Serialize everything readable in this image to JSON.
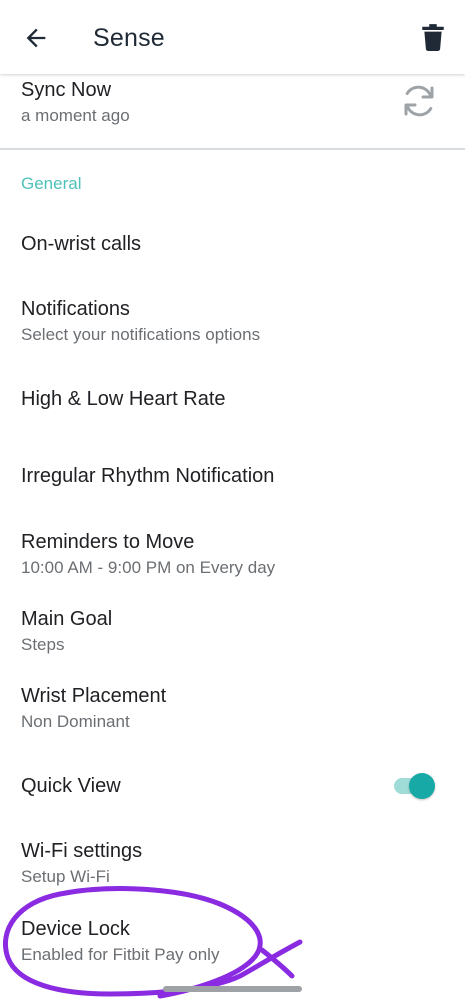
{
  "header": {
    "title": "Sense",
    "back_icon": "arrow-back-icon",
    "delete_icon": "trash-icon"
  },
  "sync": {
    "title": "Sync Now",
    "subtitle": "a moment ago",
    "icon": "sync-icon"
  },
  "general": {
    "header": "General",
    "items": [
      {
        "title": "On-wrist calls",
        "subtitle": ""
      },
      {
        "title": "Notifications",
        "subtitle": "Select your notifications options"
      },
      {
        "title": "High & Low Heart Rate",
        "subtitle": ""
      },
      {
        "title": "Irregular Rhythm Notification",
        "subtitle": ""
      },
      {
        "title": "Reminders to Move",
        "subtitle": "10:00 AM - 9:00 PM on Every day"
      },
      {
        "title": "Main Goal",
        "subtitle": "Steps"
      },
      {
        "title": "Wrist Placement",
        "subtitle": "Non Dominant"
      },
      {
        "title": "Quick View",
        "subtitle": "",
        "toggle": true
      },
      {
        "title": "Wi-Fi settings",
        "subtitle": "Setup Wi-Fi"
      },
      {
        "title": "Device Lock",
        "subtitle": "Enabled for Fitbit Pay only"
      }
    ]
  },
  "colors": {
    "accent": "#16a9a5",
    "section_header": "#4fc1bb",
    "annotation": "#8a2be2"
  }
}
